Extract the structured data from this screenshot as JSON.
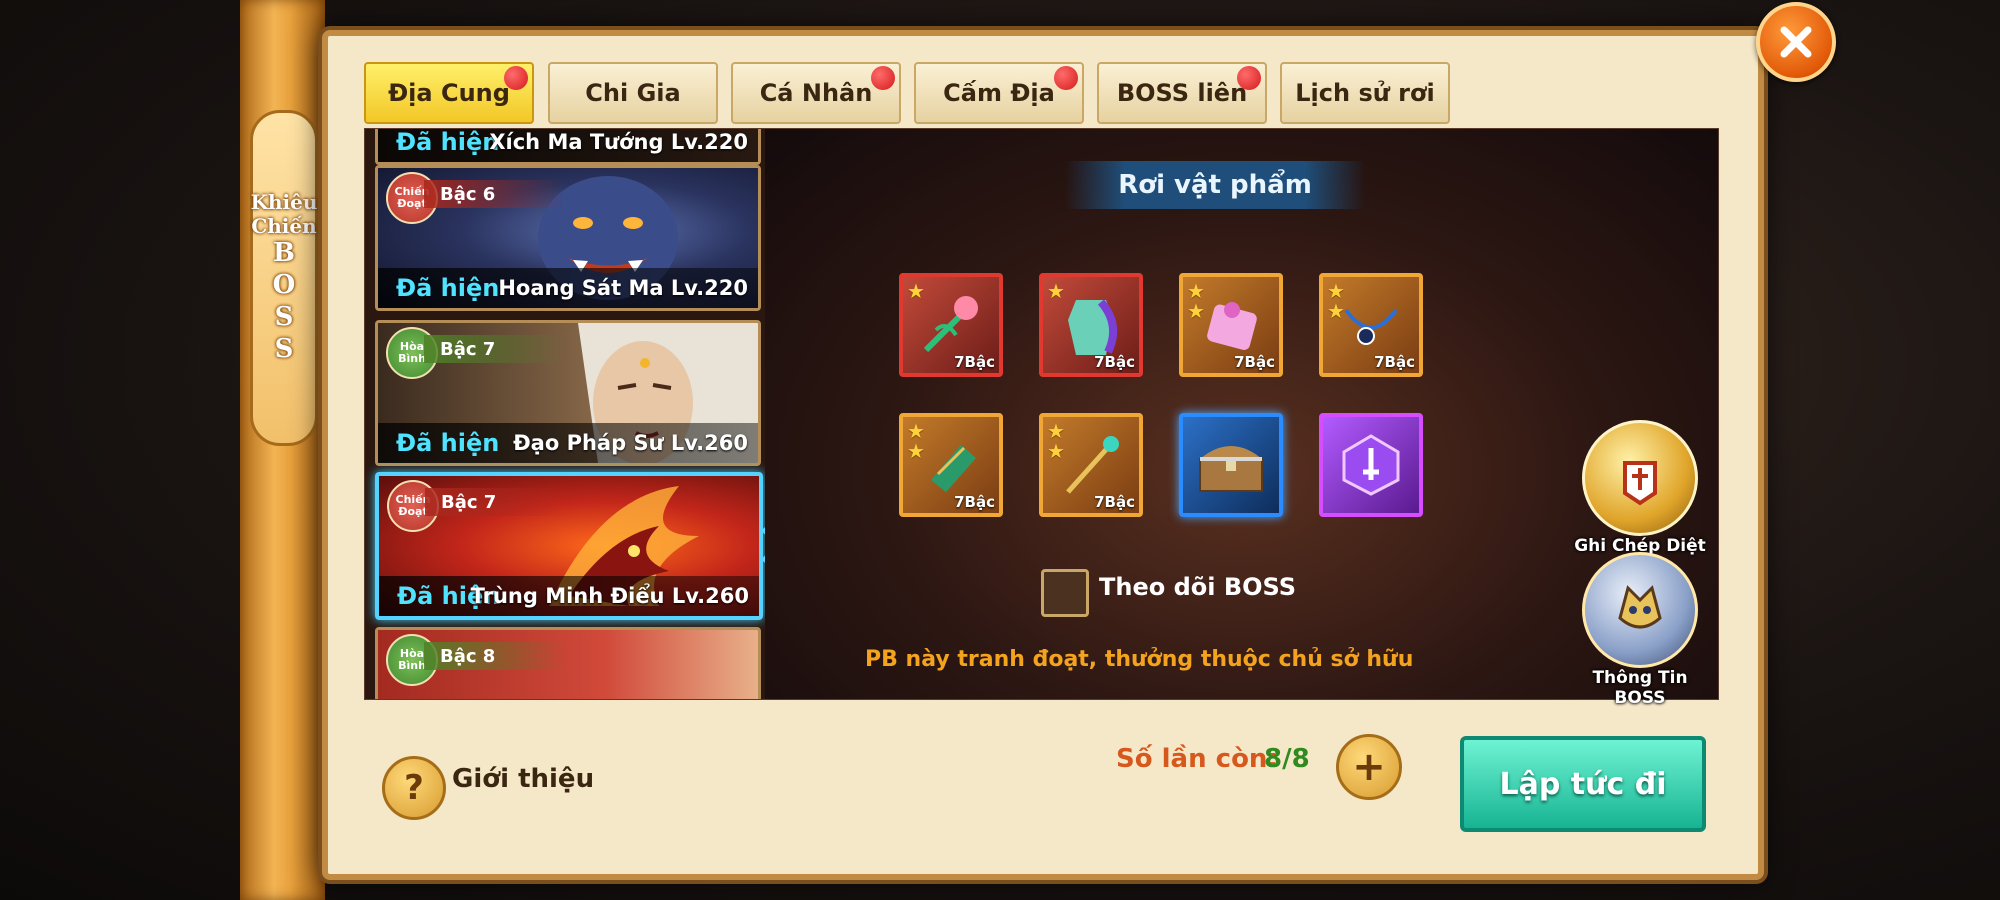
{
  "side_banner": {
    "line1": "Khiêu",
    "line2": "Chiến",
    "line3": "BOSS"
  },
  "tabs": [
    {
      "label": "Địa Cung",
      "active": true,
      "dot": true
    },
    {
      "label": "Chi Gia",
      "active": false,
      "dot": false
    },
    {
      "label": "Cá Nhân",
      "active": false,
      "dot": true
    },
    {
      "label": "Cấm Địa",
      "active": false,
      "dot": true
    },
    {
      "label": "BOSS liên",
      "active": false,
      "dot": true
    },
    {
      "label": "Lịch sử rơi",
      "active": false,
      "dot": false
    }
  ],
  "boss_list": [
    {
      "status": "Đã hiện",
      "name": "Xích Ma Tướng Lv.220",
      "badge": "",
      "rank": ""
    },
    {
      "status": "Đã hiện",
      "name": "Hoang Sát Ma Lv.220",
      "badge": "Chiến Đoạt",
      "rank": "Bậc 6"
    },
    {
      "status": "Đã hiện",
      "name": "Đạo Pháp Sư Lv.260",
      "badge": "Hòa Bình",
      "rank": "Bậc 7"
    },
    {
      "status": "Đã hiện",
      "name": "Trùng Minh Điểu Lv.260",
      "badge": "Chiến Đoạt",
      "rank": "Bậc 7"
    },
    {
      "status": "",
      "name": "",
      "badge": "Hòa Bình",
      "rank": "Bậc 8"
    }
  ],
  "drops": {
    "title": "Rơi vật phẩm",
    "items": [
      {
        "icon": "lotus-staff-icon",
        "grade": "7Bậc",
        "stars": 1,
        "frame": "red"
      },
      {
        "icon": "armor-icon",
        "grade": "7Bậc",
        "stars": 1,
        "frame": "red"
      },
      {
        "icon": "scroll-icon",
        "grade": "7Bậc",
        "stars": 2,
        "frame": "orange"
      },
      {
        "icon": "necklace-icon",
        "grade": "7Bậc",
        "stars": 2,
        "frame": "orange"
      },
      {
        "icon": "bracer-icon",
        "grade": "7Bậc",
        "stars": 2,
        "frame": "orange"
      },
      {
        "icon": "scepter-icon",
        "grade": "7Bậc",
        "stars": 2,
        "frame": "orange"
      },
      {
        "icon": "treasure-chest-icon",
        "grade": "",
        "stars": 0,
        "frame": "blue"
      },
      {
        "icon": "purple-gem-icon",
        "grade": "",
        "stars": 0,
        "frame": "purple"
      }
    ]
  },
  "follow_label": "Theo dõi BOSS",
  "note": "PB này tranh đoạt, thưởng thuộc chủ sở hữu",
  "side_icons": {
    "record": "Ghi Chép Diệt",
    "info": "Thông Tin BOSS"
  },
  "bottom": {
    "help_label": "Giới thiệu",
    "remain_label": "Số lần còn:",
    "remain_value": "8/8",
    "go_label": "Lập tức đi"
  },
  "colors": {
    "accent_gold": "#f2c726",
    "status_cyan": "#4fe3ff",
    "go_green": "#17b493"
  }
}
